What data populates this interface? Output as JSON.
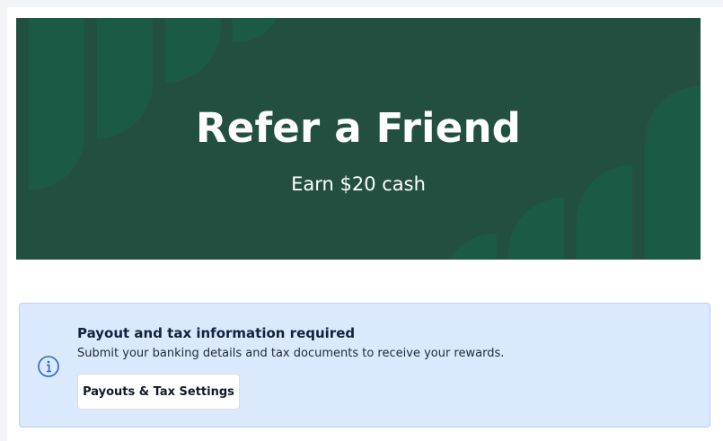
{
  "hero": {
    "title": "Refer a Friend",
    "subtitle": "Earn $20 cash",
    "background_color": "#234f41",
    "shape_color": "#1b5b45"
  },
  "alert": {
    "icon": "info-icon",
    "title": "Payout and tax information required",
    "body": "Submit your banking details and tax documents to receive your rewards.",
    "button_label": "Payouts & Tax Settings",
    "background_color": "#dbe9fe",
    "icon_color": "#2563c9"
  }
}
